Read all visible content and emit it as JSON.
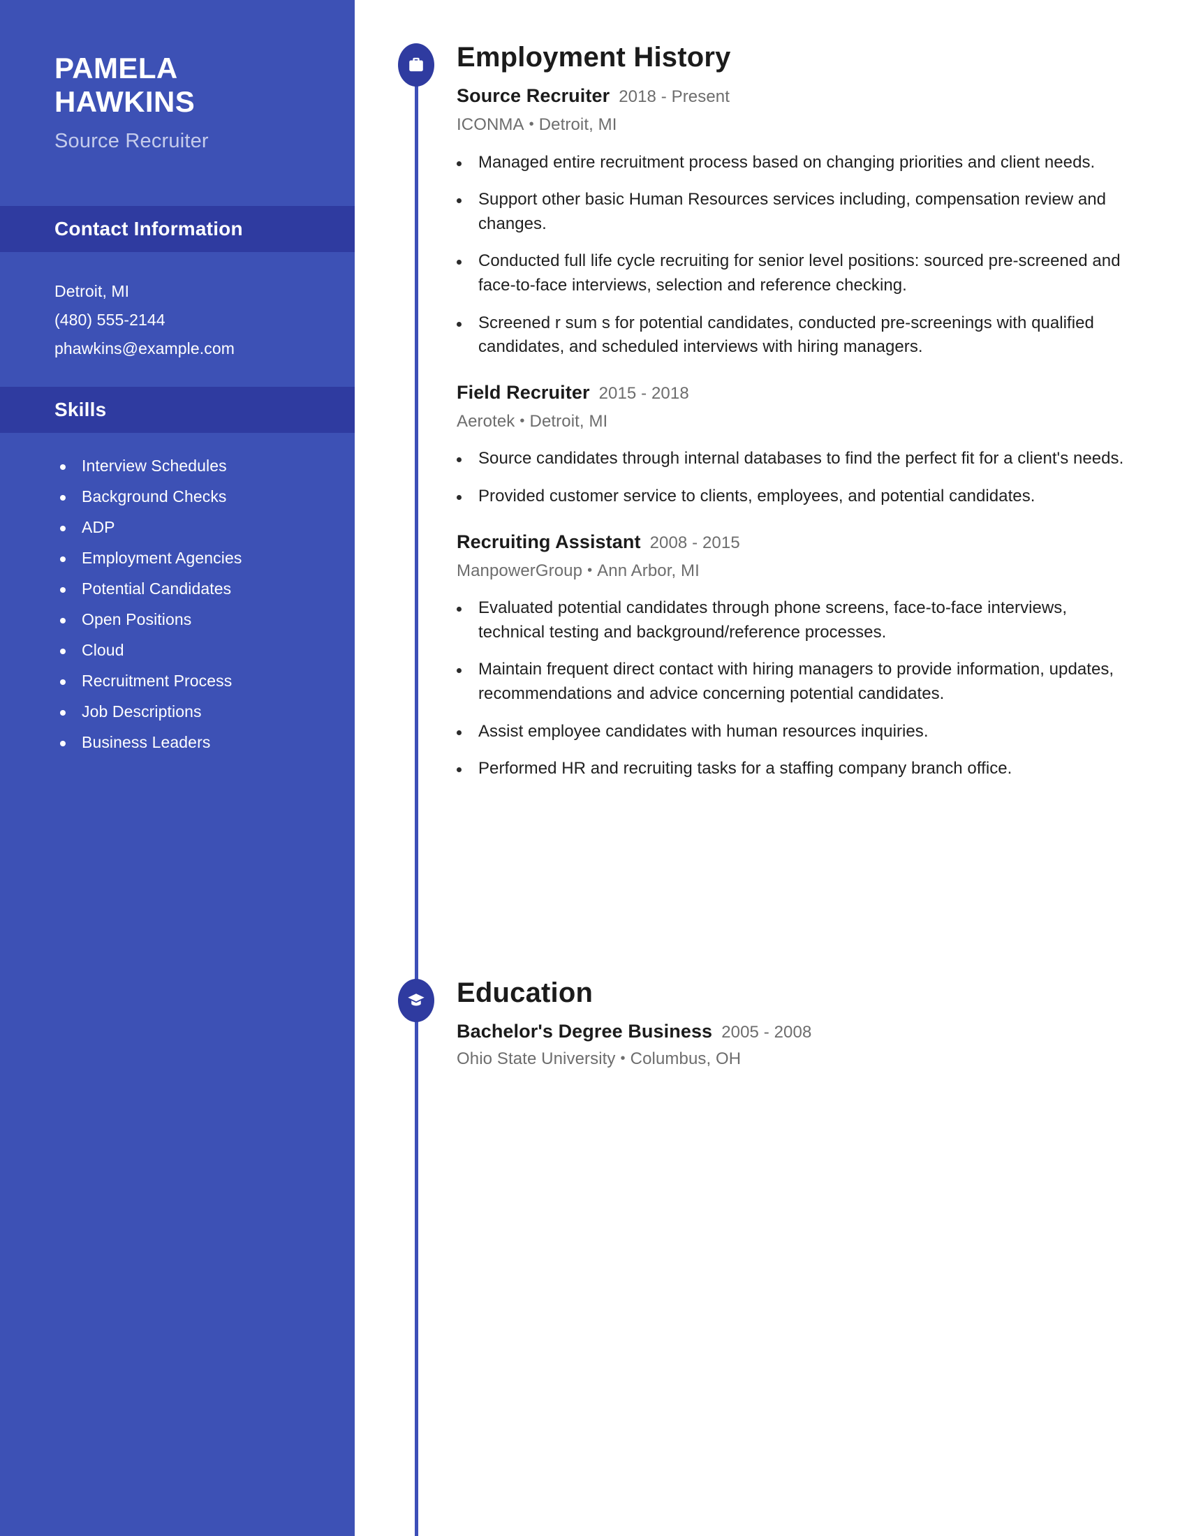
{
  "theme": {
    "sidebar_bg": "#3D51B5",
    "sidebar_header_bg": "#2F3BA0",
    "accent": "#2F3BA0",
    "rail_color": "#3D4FB8",
    "text_dark": "#1B1B1B",
    "text_muted": "#6D6D6D",
    "subtitle_color": "#C5CCEC"
  },
  "sidebar": {
    "name_line1": "PAMELA",
    "name_line2": "HAWKINS",
    "job_title": "Source Recruiter",
    "contact_heading": "Contact Information",
    "contact": [
      "Detroit, MI",
      "(480) 555-2144",
      "phawkins@example.com"
    ],
    "skills_heading": "Skills",
    "skills": [
      "Interview Schedules",
      "Background Checks",
      "ADP",
      "Employment Agencies",
      "Potential Candidates",
      "Open Positions",
      "Cloud",
      "Recruitment Process",
      "Job Descriptions",
      "Business Leaders"
    ]
  },
  "sections": [
    {
      "id": "employment",
      "title": "Employment History",
      "icon": "briefcase-icon",
      "entries": [
        {
          "role": "Source Recruiter",
          "dates": "2018 - Present",
          "company": "ICONMA",
          "location": "Detroit, MI",
          "bullets": [
            "Managed entire recruitment process based on changing priorities and client needs.",
            "Support other basic Human Resources services including, compensation review and changes.",
            "Conducted full life cycle recruiting for senior level positions: sourced pre-screened and face-to-face interviews, selection and reference checking.",
            "Screened r sum s for potential candidates, conducted pre-screenings with qualified candidates, and scheduled interviews with hiring managers."
          ]
        },
        {
          "role": "Field Recruiter",
          "dates": "2015 - 2018",
          "company": "Aerotek",
          "location": "Detroit, MI",
          "bullets": [
            "Source candidates through internal databases to find the perfect fit for a client's needs.",
            "Provided customer service to clients, employees, and potential candidates."
          ]
        },
        {
          "role": "Recruiting Assistant",
          "dates": "2008 - 2015",
          "company": "ManpowerGroup",
          "location": "Ann Arbor, MI",
          "bullets": [
            "Evaluated potential candidates through phone screens, face-to-face interviews, technical testing and background/reference processes.",
            "Maintain frequent direct contact with hiring managers to provide information, updates, recommendations and advice concerning potential candidates.",
            "Assist employee candidates with human resources inquiries.",
            "Performed HR and recruiting tasks for a staffing company branch office."
          ]
        }
      ]
    },
    {
      "id": "education",
      "title": "Education",
      "icon": "graduation-cap-icon",
      "entries": [
        {
          "role": "Bachelor's Degree Business",
          "dates": "2005 - 2008",
          "company": "Ohio State University",
          "location": "Columbus, OH",
          "bullets": []
        }
      ]
    }
  ],
  "separator": "•"
}
